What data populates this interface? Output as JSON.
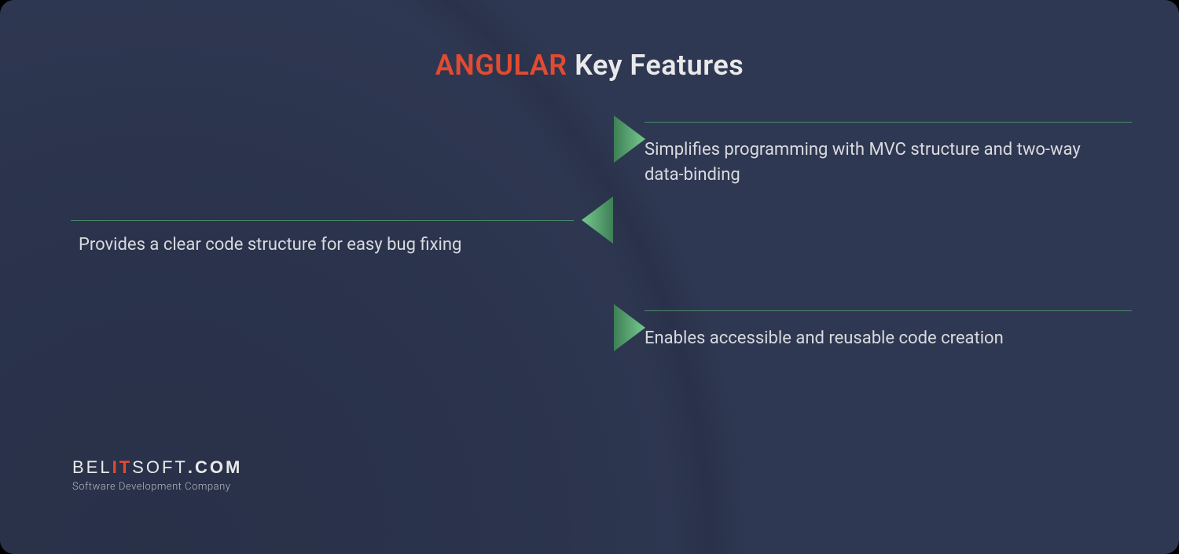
{
  "title": {
    "accent": "ANGULAR",
    "rest": " Key Features"
  },
  "features": {
    "left": "Provides a clear code structure for easy bug fixing",
    "right_top": "Simplifies programming with MVC structure and two-way data-binding",
    "right_bottom": "Enables accessible and reusable code creation"
  },
  "logo": {
    "part1": "BEL",
    "part2": "IT",
    "part3": "SOFT",
    "part4": ".COM",
    "tagline": "Software Development Company"
  },
  "colors": {
    "bg": "#2f3852",
    "accent": "#e24b31",
    "line": "#4f9c6f",
    "triangle_dark": "#3e7f56",
    "triangle_light": "#6cbf87",
    "text": "#d9dade"
  }
}
